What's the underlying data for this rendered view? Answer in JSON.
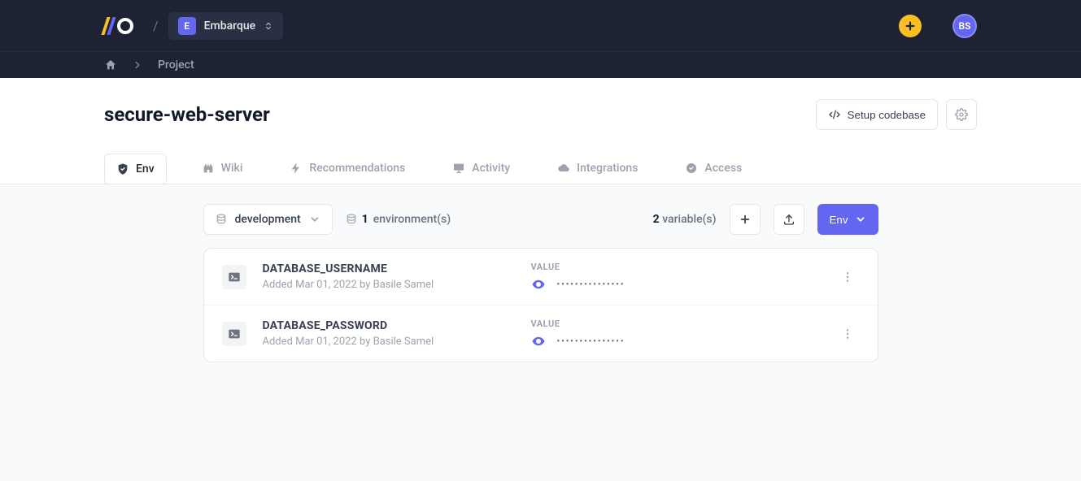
{
  "nav": {
    "workspace_initial": "E",
    "workspace_name": "Embarque",
    "avatar_initials": "BS"
  },
  "breadcrumb": {
    "current": "Project"
  },
  "header": {
    "title": "secure-web-server",
    "setup_codebase_label": "Setup codebase"
  },
  "tabs": [
    {
      "id": "env",
      "label": "Env",
      "icon": "shield-check",
      "active": true
    },
    {
      "id": "wiki",
      "label": "Wiki",
      "icon": "castle",
      "active": false
    },
    {
      "id": "recommendations",
      "label": "Recommendations",
      "icon": "bolt",
      "active": false
    },
    {
      "id": "activity",
      "label": "Activity",
      "icon": "presentation",
      "active": false
    },
    {
      "id": "integrations",
      "label": "Integrations",
      "icon": "cloud",
      "active": false
    },
    {
      "id": "access",
      "label": "Access",
      "icon": "badge-check",
      "active": false
    }
  ],
  "toolbar": {
    "env_selected": "development",
    "env_count": "1",
    "env_count_suffix": "environment(s)",
    "var_count": "2",
    "var_count_suffix": "variable(s)",
    "env_button_label": "Env"
  },
  "variables": [
    {
      "name": "DATABASE_USERNAME",
      "meta": "Added Mar 01, 2022 by Basile Samel",
      "value_label": "VALUE",
      "masked": "•••••••••••••••"
    },
    {
      "name": "DATABASE_PASSWORD",
      "meta": "Added Mar 01, 2022 by Basile Samel",
      "value_label": "VALUE",
      "masked": "•••••••••••••••"
    }
  ]
}
